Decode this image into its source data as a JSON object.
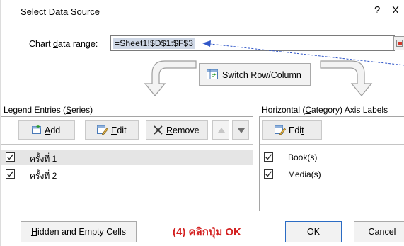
{
  "dialog": {
    "title": "Select Data Source",
    "help_glyph": "?",
    "close_glyph": "X"
  },
  "range": {
    "label_pre": "Chart ",
    "label_accel": "d",
    "label_post": "ata range:",
    "value": "=Sheet1!$D$1:$F$3"
  },
  "switch": {
    "label_pre": "S",
    "label_accel": "w",
    "label_post": "itch Row/Column"
  },
  "legend": {
    "heading_pre": "Legend Entries (",
    "heading_accel": "S",
    "heading_post": "eries)",
    "add_accel": "A",
    "add_post": "dd",
    "edit_accel": "E",
    "edit_post": "dit",
    "remove_accel": "R",
    "remove_post": "emove",
    "items": [
      {
        "label": "ครั้งที่ 1",
        "checked": true,
        "selected": true
      },
      {
        "label": "ครั้งที่ 2",
        "checked": true,
        "selected": false
      }
    ]
  },
  "axis": {
    "heading_pre": "Horizontal (",
    "heading_accel": "C",
    "heading_post": "ategory) Axis Labels",
    "edit_pre": "Edi",
    "edit_accel": "t",
    "items": [
      {
        "label": "Book(s)",
        "checked": true
      },
      {
        "label": "Media(s)",
        "checked": true
      }
    ]
  },
  "footer": {
    "hidden_pre": "",
    "hidden_accel": "H",
    "hidden_post": "idden and Empty Cells",
    "ok_label": "OK",
    "cancel_label": "Cancel"
  },
  "annotation": {
    "text": "(4) คลิกปุ่ม OK",
    "color": "#d32020"
  },
  "colors": {
    "range_highlight": "#cfd8e6",
    "selected_row": "#e5e5e5",
    "pointer_arrow": "#2f56c8"
  }
}
